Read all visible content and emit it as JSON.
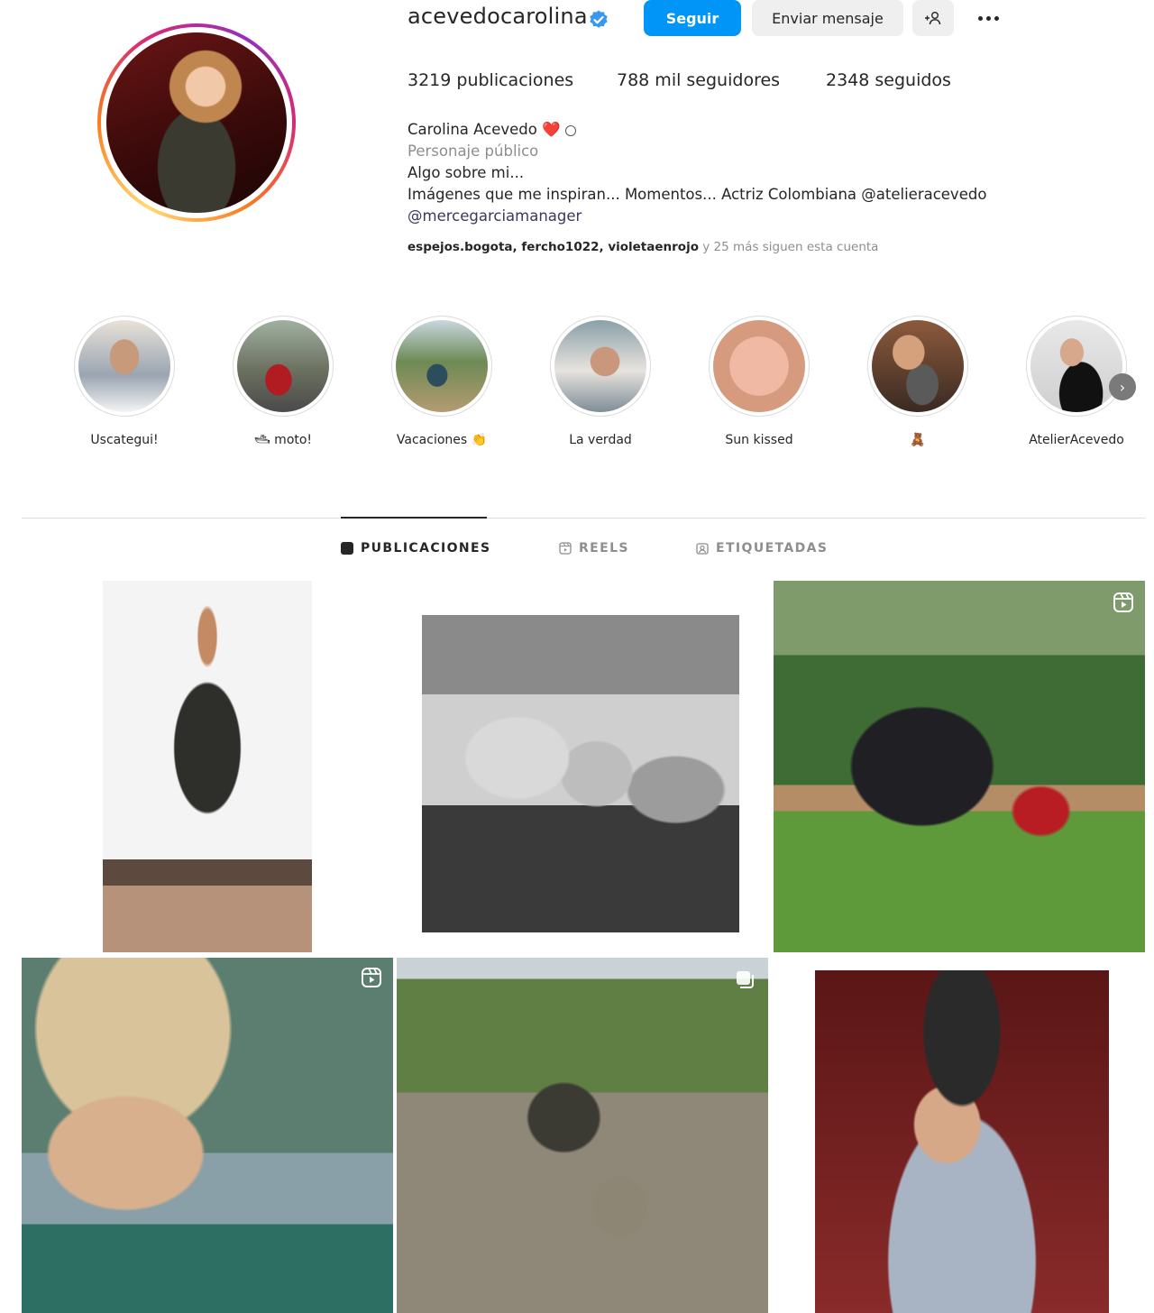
{
  "profile": {
    "username": "acevedocarolina",
    "verified_icon": "verified-badge-icon",
    "follow_label": "Seguir",
    "message_label": "Enviar mensaje",
    "suggest_icon": "add-person-icon",
    "more_icon": "more-options-icon",
    "posts": "3219 publicaciones",
    "followers": "788 mil seguidores",
    "following": "2348 seguidos",
    "full_name": "Carolina Acevedo",
    "full_name_emoji": "❤️",
    "category": "Personaje público",
    "bio_line1": "Algo sobre mi...",
    "bio_line2": "Imágenes que me inspiran... Momentos... Actriz Colombiana @atelieracevedo",
    "bio_line3": "@mercegarciamanager",
    "followed_by_names": "espejos.bogota, fercho1022, violetaenrojo",
    "followed_by_rest": " y 25 más siguen esta cuenta"
  },
  "highlights": [
    {
      "label": "Uscategui!"
    },
    {
      "label": "🛥 moto!"
    },
    {
      "label": "Vacaciones 👏"
    },
    {
      "label": "La verdad"
    },
    {
      "label": "Sun kissed"
    },
    {
      "label": "🧸"
    },
    {
      "label": "AtelierAcevedo"
    }
  ],
  "tabs": [
    {
      "label": "PUBLICACIONES",
      "active": true
    },
    {
      "label": "REELS",
      "active": false
    },
    {
      "label": "ETIQUETADAS",
      "active": false
    }
  ],
  "colors": {
    "accent": "#0095f6",
    "text": "#262626",
    "muted": "#8e8e8e",
    "border": "#dbdbdb"
  }
}
